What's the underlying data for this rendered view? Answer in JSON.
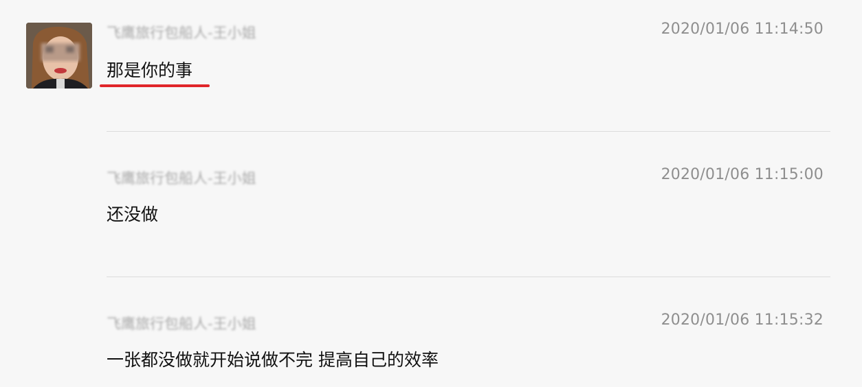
{
  "messages": [
    {
      "sender": "飞鹰旅行包船人-王小姐",
      "time": "2020/01/06 11:14:50",
      "text": "那是你的事"
    },
    {
      "sender": "飞鹰旅行包船人-王小姐",
      "time": "2020/01/06 11:15:00",
      "text": "还没做"
    },
    {
      "sender": "飞鹰旅行包船人-王小姐",
      "time": "2020/01/06 11:15:32",
      "text": "一张都没做就开始说做不完 提高自己的效率"
    }
  ],
  "colors": {
    "background": "#f7f7f7",
    "underline": "#e0262a",
    "timestamp": "#8e8e8e",
    "divider": "#dcdcdc"
  }
}
